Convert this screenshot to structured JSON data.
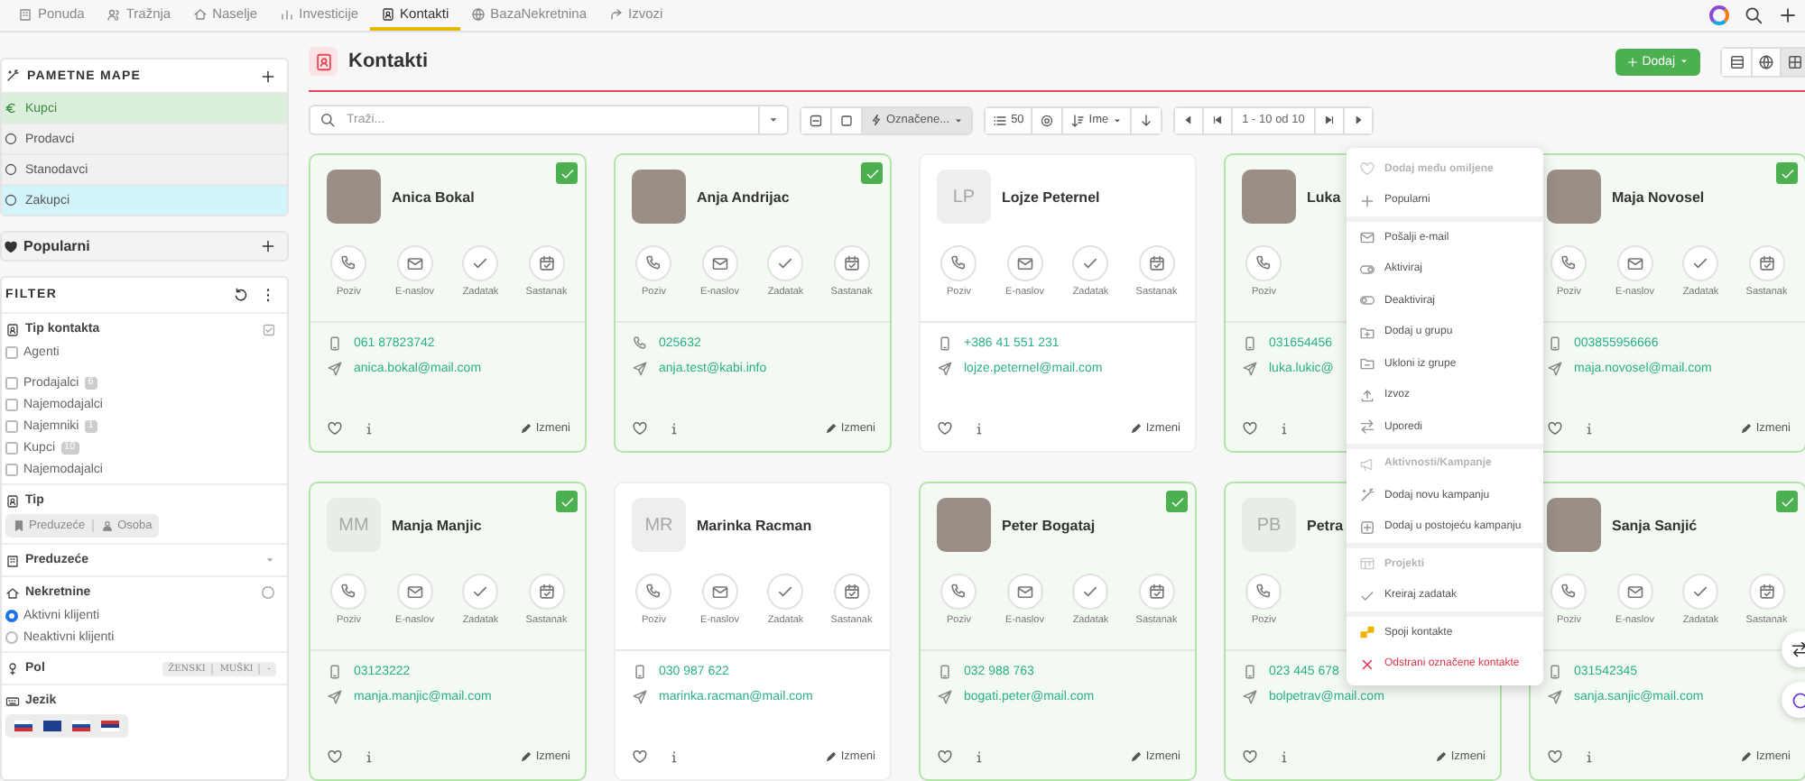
{
  "top_nav": {
    "tabs": [
      {
        "label": "Ponuda",
        "selected": false
      },
      {
        "label": "Tražnja",
        "selected": false
      },
      {
        "label": "Naselje",
        "selected": false
      },
      {
        "label": "Investicije",
        "selected": false
      },
      {
        "label": "Kontakti",
        "selected": true
      },
      {
        "label": "BazaNekretnina",
        "selected": false
      },
      {
        "label": "Izvozi",
        "selected": false
      }
    ]
  },
  "sidebar": {
    "smart_folders": {
      "title": "PAMETNE MAPE",
      "items": [
        {
          "label": "Kupci",
          "selected": true,
          "highlighted": false
        },
        {
          "label": "Prodavci",
          "selected": false,
          "highlighted": false
        },
        {
          "label": "Stanodavci",
          "selected": false,
          "highlighted": false
        },
        {
          "label": "Zakupci",
          "selected": false,
          "highlighted": true
        }
      ]
    },
    "popular": {
      "title": "Popularni"
    },
    "filter": {
      "title": "FILTER",
      "contact_type": {
        "title": "Tip kontakta",
        "options": [
          {
            "label": "Agenti",
            "checked": false
          },
          {
            "label": "Prodajalci",
            "checked": false,
            "count": "6"
          },
          {
            "label": "Najemodajalci",
            "checked": false
          },
          {
            "label": "Najemniki",
            "checked": false,
            "count": "1"
          },
          {
            "label": "Kupci",
            "checked": false,
            "count": "10"
          },
          {
            "label": "Najemodajalci",
            "checked": false
          }
        ]
      },
      "type": {
        "title": "Tip",
        "options": [
          "Preduzeće",
          "Osoba"
        ]
      },
      "company": {
        "title": "Preduzeće"
      },
      "properties": {
        "title": "Nekretnine",
        "options": [
          {
            "label": "Aktivni klijenti",
            "selected": true
          },
          {
            "label": "Neaktivni klijenti",
            "selected": false
          }
        ]
      },
      "gender": {
        "title": "Pol",
        "options": [
          "ŽENSKI",
          "MUŠKI",
          "-"
        ]
      },
      "language": {
        "title": "Jezik"
      }
    }
  },
  "page": {
    "title": "Kontakti",
    "add_button": "Dodaj",
    "views": [
      {
        "selected": false
      },
      {
        "selected": false
      },
      {
        "selected": true
      }
    ]
  },
  "search": {
    "placeholder": "Traži..."
  },
  "toolbar": {
    "selection_button": "Označene...",
    "page_size": "50",
    "sort": "Ime",
    "pagination": "1 - 10 od 10"
  },
  "contacts": [
    {
      "name": "Anica Bokal",
      "selected": true,
      "avatar": {
        "kind": "photo"
      },
      "actions": [
        "Poziv",
        "E-naslov",
        "Zadatak",
        "Sastanak"
      ],
      "phone": "061 87823742",
      "email": "anica.bokal@mail.com",
      "edit": "Izmeni"
    },
    {
      "name": "Anja Andrijac",
      "selected": true,
      "avatar": {
        "kind": "photo"
      },
      "actions": [
        "Poziv",
        "E-naslov",
        "Zadatak",
        "Sastanak"
      ],
      "phone": "025632",
      "email": "anja.test@kabi.info",
      "edit": "Izmeni"
    },
    {
      "name": "Lojze Peternel",
      "selected": false,
      "avatar": {
        "kind": "initials",
        "text": "LP"
      },
      "actions": [
        "Poziv",
        "E-naslov",
        "Zadatak",
        "Sastanak"
      ],
      "phone": "+386 41 551 231",
      "email": "lojze.peternel@mail.com",
      "edit": "Izmeni"
    },
    {
      "name": "Luka",
      "selected": true,
      "avatar": {
        "kind": "photo"
      },
      "actions": [
        "Poziv"
      ],
      "phone": "031654456",
      "email": "luka.lukic@"
    },
    {
      "name": "Maja Novosel",
      "selected": true,
      "avatar": {
        "kind": "photo"
      },
      "actions": [
        "Poziv",
        "E-naslov",
        "Zadatak",
        "Sastanak"
      ],
      "phone": "003855956666",
      "email": "maja.novosel@mail.com",
      "edit": "Izmeni"
    },
    {
      "name": "Manja Manjic",
      "selected": true,
      "avatar": {
        "kind": "initials",
        "text": "MM"
      },
      "actions": [
        "Poziv",
        "E-naslov",
        "Zadatak",
        "Sastanak"
      ],
      "phone": "03123222",
      "email": "manja.manjic@mail.com",
      "edit": "Izmeni"
    },
    {
      "name": "Marinka Racman",
      "selected": false,
      "avatar": {
        "kind": "initials",
        "text": "MR"
      },
      "actions": [
        "Poziv",
        "E-naslov",
        "Zadatak",
        "Sastanak"
      ],
      "phone": "030 987 622",
      "email": "marinka.racman@mail.com",
      "edit": "Izmeni"
    },
    {
      "name": "Peter Bogataj",
      "selected": true,
      "avatar": {
        "kind": "photo"
      },
      "actions": [
        "Poziv",
        "E-naslov",
        "Zadatak",
        "Sastanak"
      ],
      "phone": "032 988 763",
      "email": "bogati.peter@mail.com",
      "edit": "Izmeni"
    },
    {
      "name": "Petra",
      "selected": true,
      "avatar": {
        "kind": "initials",
        "text": "PB"
      },
      "actions": [
        "Poziv"
      ],
      "phone": "023 445 678",
      "email": "bolpetrav@mail.com",
      "edit": "Izmeni"
    },
    {
      "name": "Sanja Sanjić",
      "selected": true,
      "avatar": {
        "kind": "photo"
      },
      "actions": [
        "Poziv",
        "E-naslov",
        "Zadatak",
        "Sastanak"
      ],
      "phone": "031542345",
      "email": "sanja.sanjic@mail.com",
      "edit": "Izmeni"
    }
  ],
  "bulk_menu": {
    "groups": [
      {
        "items": [
          {
            "label": "Dodaj među omiljene",
            "kind": "disabled"
          },
          {
            "label": "Popularni",
            "kind": "item"
          }
        ]
      },
      {
        "items": [
          {
            "label": "Pošalji e-mail",
            "kind": "item"
          },
          {
            "label": "Aktiviraj",
            "kind": "item"
          },
          {
            "label": "Deaktiviraj",
            "kind": "item"
          },
          {
            "label": "Dodaj u grupu",
            "kind": "item"
          },
          {
            "label": "Ukloni iz grupe",
            "kind": "item"
          },
          {
            "label": "Izvoz",
            "kind": "item"
          },
          {
            "label": "Uporedi",
            "kind": "item"
          }
        ]
      },
      {
        "items": [
          {
            "label": "Aktivnosti/Kampanje",
            "kind": "header"
          },
          {
            "label": "Dodaj novu kampanju",
            "kind": "item"
          },
          {
            "label": "Dodaj u postojeću kampanju",
            "kind": "item"
          }
        ]
      },
      {
        "items": [
          {
            "label": "Projekti",
            "kind": "header"
          },
          {
            "label": "Kreiraj zadatak",
            "kind": "item"
          }
        ]
      },
      {
        "items": [
          {
            "label": "Spoji kontakte",
            "kind": "item"
          },
          {
            "label": "Odstrani označene kontakte",
            "kind": "danger"
          }
        ]
      }
    ]
  }
}
